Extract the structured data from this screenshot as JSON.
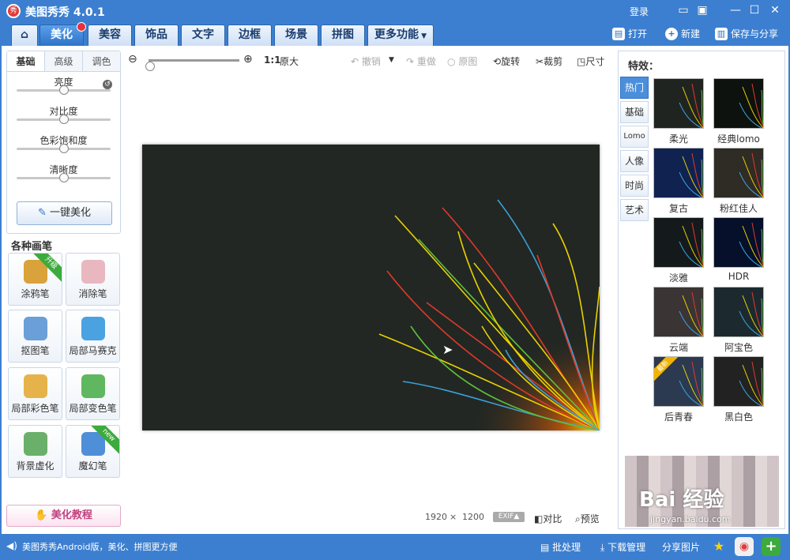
{
  "app": {
    "title": "美图秀秀 4.0.1",
    "logo_char": "秀",
    "login": "登录"
  },
  "tabs": [
    {
      "label": ""
    },
    {
      "label": "美化"
    },
    {
      "label": "美容"
    },
    {
      "label": "饰品"
    },
    {
      "label": "文字"
    },
    {
      "label": "边框"
    },
    {
      "label": "场景"
    },
    {
      "label": "拼图"
    },
    {
      "label": "更多功能"
    }
  ],
  "actions": {
    "open": "打开",
    "new": "新建",
    "save": "保存与分享"
  },
  "adjust": {
    "tabs": [
      "基础",
      "高级",
      "调色"
    ],
    "sliders": [
      {
        "label": "亮度",
        "value": 0.5
      },
      {
        "label": "对比度",
        "value": 0.5
      },
      {
        "label": "色彩饱和度",
        "value": 0.5
      },
      {
        "label": "清晰度",
        "value": 0.5
      }
    ],
    "one_click": "一键美化"
  },
  "brushes": {
    "title": "各种画笔",
    "items": [
      {
        "label": "涂鸦笔",
        "badge": "升级",
        "color": "#d9a23a"
      },
      {
        "label": "消除笔",
        "badge": "",
        "color": "#e9b7c0"
      },
      {
        "label": "抠图笔",
        "badge": "",
        "color": "#6a9fd8"
      },
      {
        "label": "局部马赛克",
        "badge": "",
        "color": "#4aa3e0"
      },
      {
        "label": "局部彩色笔",
        "badge": "",
        "color": "#e6b34a"
      },
      {
        "label": "局部变色笔",
        "badge": "",
        "color": "#5fb85f"
      },
      {
        "label": "背景虚化",
        "badge": "",
        "color": "#6ab06a"
      },
      {
        "label": "魔幻笔",
        "badge": "new",
        "color": "#4f8fd8"
      }
    ]
  },
  "tutorial": "美化教程",
  "toolbar": {
    "scale": "1:1",
    "original_size": "原大",
    "undo": "撤销",
    "redo": "重做",
    "original": "原图",
    "rotate": "旋转",
    "crop": "裁剪",
    "resize": "尺寸"
  },
  "image_info": {
    "width": "1920",
    "times": "×",
    "height": "1200",
    "exif": "EXIF▲",
    "compare": "对比",
    "preview": "预览"
  },
  "effects": {
    "title": "特效：",
    "categories": [
      "热门",
      "基础",
      "Lomo",
      "人像",
      "时尚",
      "艺术"
    ],
    "items": [
      {
        "label": "柔光",
        "bg": "#1f2420",
        "badge": ""
      },
      {
        "label": "经典lomo",
        "bg": "#0d120e",
        "badge": ""
      },
      {
        "label": "复古",
        "bg": "#102250",
        "badge": ""
      },
      {
        "label": "粉红佳人",
        "bg": "#2f2b25",
        "badge": ""
      },
      {
        "label": "淡雅",
        "bg": "#141a1c",
        "badge": ""
      },
      {
        "label": "HDR",
        "bg": "#06102a",
        "badge": ""
      },
      {
        "label": "云端",
        "bg": "#3a3434",
        "badge": ""
      },
      {
        "label": "阿宝色",
        "bg": "#1c2a30",
        "badge": ""
      },
      {
        "label": "后青春",
        "bg": "#2b3a50",
        "badge": "最新"
      },
      {
        "label": "黑白色",
        "bg": "#222222",
        "badge": ""
      }
    ]
  },
  "watermark": {
    "text": "Bai 经验",
    "url": "jingyan.baidu.com"
  },
  "status": {
    "message": "美图秀秀Android版，美化、拼图更方便",
    "batch": "批处理",
    "download": "下载管理",
    "share": "分享图片"
  },
  "colors": {
    "accent": "#3c7fd0",
    "active_tab": "#2e73c6",
    "new_badge": "#3daa3d"
  }
}
